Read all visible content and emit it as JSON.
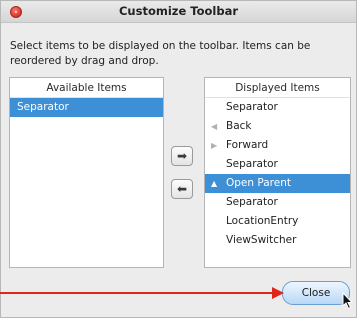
{
  "window": {
    "title": "Customize Toolbar"
  },
  "description": "Select items to be displayed on the toolbar. Items can be reordered by drag and drop.",
  "available": {
    "header": "Available Items",
    "items": [
      {
        "label": "Separator",
        "selected": true
      }
    ]
  },
  "displayed": {
    "header": "Displayed Items",
    "items": [
      {
        "label": "Separator",
        "icon": ""
      },
      {
        "label": "Back",
        "icon": "left-arrow-icon"
      },
      {
        "label": "Forward",
        "icon": "right-arrow-icon"
      },
      {
        "label": "Separator",
        "icon": ""
      },
      {
        "label": "Open Parent",
        "icon": "up-arrow-icon",
        "selected": true
      },
      {
        "label": "Separator",
        "icon": ""
      },
      {
        "label": "LocationEntry",
        "icon": ""
      },
      {
        "label": "ViewSwitcher",
        "icon": ""
      }
    ]
  },
  "buttons": {
    "add_glyph": "➡",
    "remove_glyph": "⬅",
    "close_label": "Close"
  },
  "colors": {
    "selection": "#3d8fd6",
    "annotation_arrow": "#e0261b",
    "close_dot": "#d9342a"
  }
}
